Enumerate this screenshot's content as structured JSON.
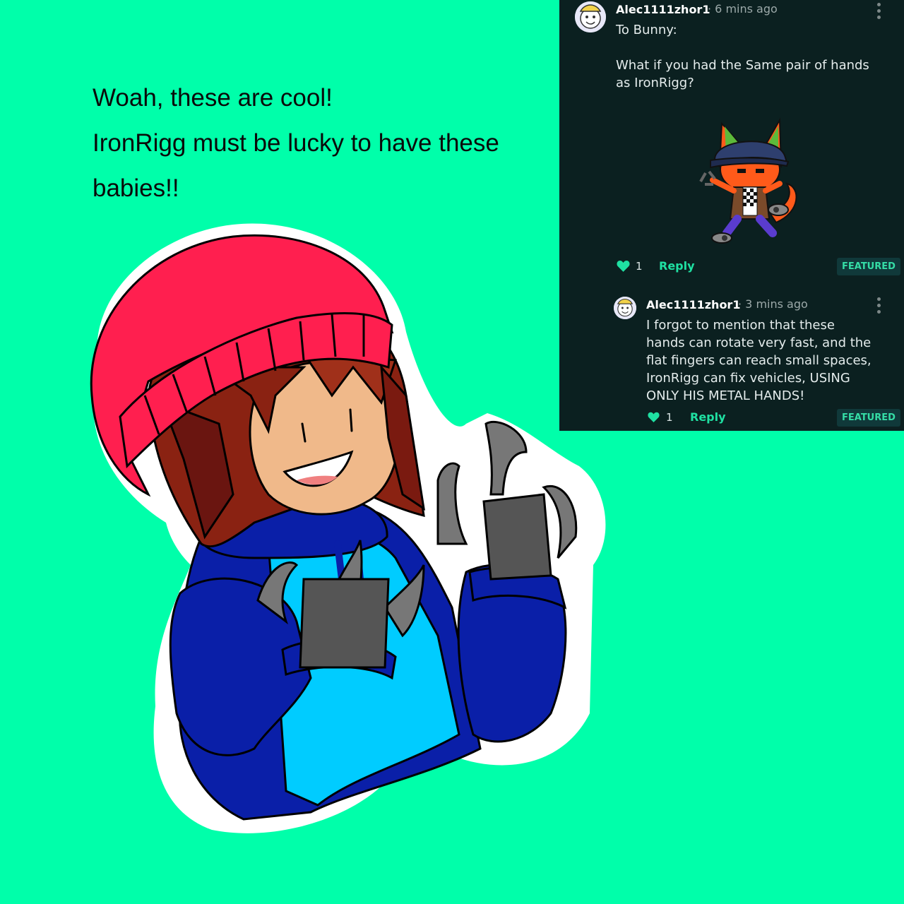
{
  "caption": {
    "line1": "Woah, these are cool!",
    "line2": "IronRigg must be lucky to have these",
    "line3": "babies!!"
  },
  "comment": {
    "username": "Alec1111zhor1",
    "time": "· 6 mins ago",
    "line1": "To Bunny:",
    "line2": "What if you had the Same pair of hands",
    "line3": "as IronRigg?",
    "likes": "1",
    "reply_label": "Reply",
    "featured_label": "FEATURED"
  },
  "reply_comment": {
    "username": "Alec1111zhor1",
    "time": "· 3 mins ago",
    "line1": "I forgot to mention that these",
    "line2": "hands can rotate very fast, and the",
    "line3": "flat fingers can reach small spaces,",
    "line4": "IronRigg can fix vehicles, USING",
    "line5": "ONLY HIS METAL HANDS!",
    "likes": "1",
    "reply_label": "Reply",
    "featured_label": "FEATURED"
  },
  "icons": {
    "heart": "heart-icon",
    "more": "more-vertical-icon"
  },
  "colors": {
    "background": "#00FFAA",
    "panel": "#0B2020",
    "accent": "#1FE0A2",
    "hat": "#FF1F4F",
    "hoodie": "#0A1FA8",
    "hoodie_light": "#00CCFF",
    "metal": "#777777"
  }
}
